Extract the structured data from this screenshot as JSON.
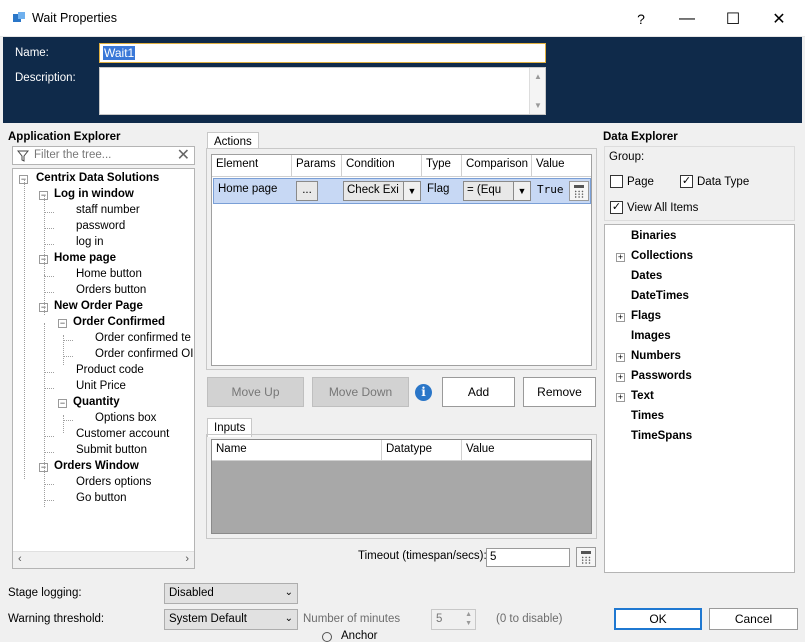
{
  "window": {
    "title": "Wait Properties",
    "help": "?",
    "minimize": "—",
    "maximize": "☐",
    "close": "✕"
  },
  "header": {
    "name_label": "Name:",
    "name_value": "Wait1",
    "description_label": "Description:"
  },
  "app_explorer": {
    "title": "Application Explorer",
    "filter_placeholder": "Filter the tree...",
    "items": [
      {
        "label": "Centrix Data Solutions",
        "bold": true
      },
      {
        "label": "Log in window",
        "bold": true
      },
      {
        "label": "staff number",
        "bold": false
      },
      {
        "label": "password",
        "bold": false
      },
      {
        "label": "log in",
        "bold": false
      },
      {
        "label": "Home page",
        "bold": true
      },
      {
        "label": "Home button",
        "bold": false
      },
      {
        "label": "Orders button",
        "bold": false
      },
      {
        "label": "New Order Page",
        "bold": true
      },
      {
        "label": "Order Confirmed",
        "bold": true
      },
      {
        "label": "Order confirmed te",
        "bold": false
      },
      {
        "label": "Order confirmed OI",
        "bold": false
      },
      {
        "label": "Product code",
        "bold": false
      },
      {
        "label": "Unit Price",
        "bold": false
      },
      {
        "label": "Quantity",
        "bold": true
      },
      {
        "label": "Options box",
        "bold": false
      },
      {
        "label": "Customer account",
        "bold": false
      },
      {
        "label": "Submit button",
        "bold": false
      },
      {
        "label": "Orders Window",
        "bold": true
      },
      {
        "label": "Orders options",
        "bold": false
      },
      {
        "label": "Go button",
        "bold": false
      }
    ]
  },
  "actions": {
    "tab_label": "Actions",
    "columns": [
      "Element",
      "Params",
      "Condition",
      "Type",
      "Comparison",
      "Value"
    ],
    "row": {
      "element": "Home page",
      "params": "...",
      "condition": "Check Exi",
      "type": "Flag",
      "comparison": "= (Equ",
      "value": "True"
    },
    "buttons": {
      "move_up": "Move Up",
      "move_down": "Move Down",
      "add": "Add",
      "remove": "Remove"
    },
    "info_glyph": "i"
  },
  "inputs": {
    "tab_label": "Inputs",
    "columns": [
      "Name",
      "Datatype",
      "Value"
    ]
  },
  "timeout": {
    "label": "Timeout (timespan/secs):",
    "value": "5"
  },
  "data_explorer": {
    "title": "Data Explorer",
    "group_label": "Group:",
    "page_label": "Page",
    "page_checked": false,
    "datatype_label": "Data Type",
    "datatype_checked": true,
    "view_all_label": "View All Items",
    "view_all_checked": true,
    "items": [
      {
        "label": "Binaries",
        "expandable": false
      },
      {
        "label": "Collections",
        "expandable": true
      },
      {
        "label": "Dates",
        "expandable": false
      },
      {
        "label": "DateTimes",
        "expandable": false
      },
      {
        "label": "Flags",
        "expandable": true
      },
      {
        "label": "Images",
        "expandable": false
      },
      {
        "label": "Numbers",
        "expandable": true
      },
      {
        "label": "Passwords",
        "expandable": true
      },
      {
        "label": "Text",
        "expandable": true
      },
      {
        "label": "Times",
        "expandable": false
      },
      {
        "label": "TimeSpans",
        "expandable": false
      }
    ]
  },
  "footer": {
    "stage_logging_label": "Stage logging:",
    "stage_logging_value": "Disabled",
    "warning_label": "Warning threshold:",
    "warning_value": "System Default",
    "minutes_label": "Number of minutes",
    "minutes_value": "5",
    "disable_hint": "(0 to disable)",
    "ok": "OK",
    "cancel": "Cancel",
    "behind_text": "Anchor"
  }
}
